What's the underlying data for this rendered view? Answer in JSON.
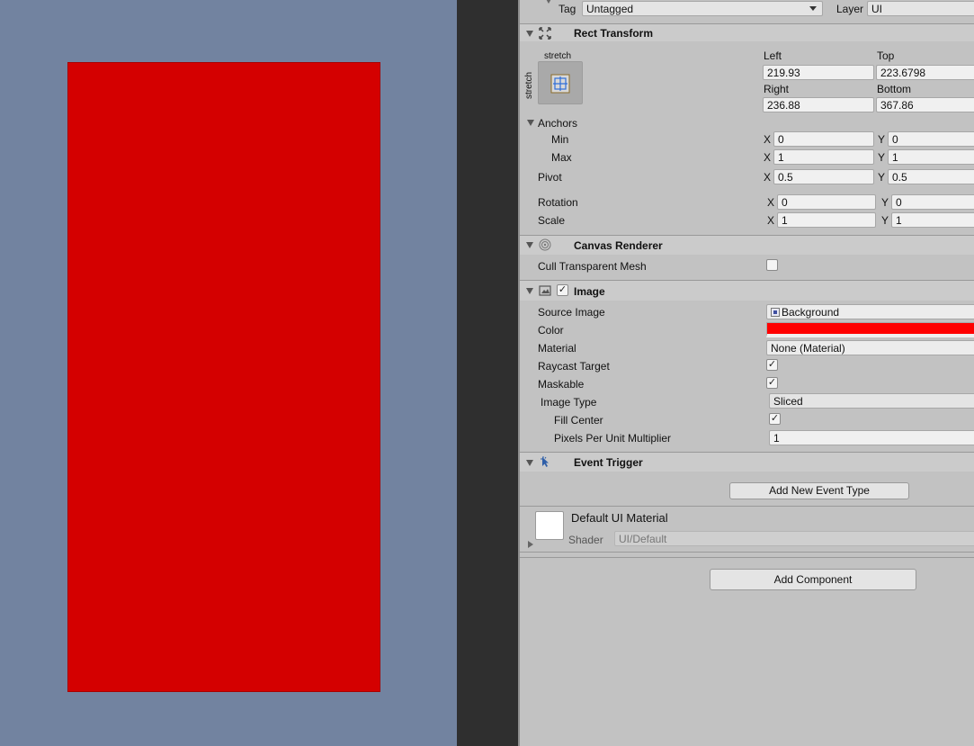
{
  "colors": {
    "scene_bg": "#7283a0",
    "image_red": "#d40000",
    "color_field": "#ff0000"
  },
  "top": {
    "tag_label": "Tag",
    "tag_value": "Untagged",
    "layer_label": "Layer",
    "layer_value": "UI"
  },
  "rect_transform": {
    "title": "Rect Transform",
    "anchor_preset_h": "stretch",
    "anchor_preset_v": "stretch",
    "left_label": "Left",
    "left_value": "219.93",
    "top_label": "Top",
    "top_value": "223.6798",
    "right_label": "Right",
    "right_value": "236.88",
    "bottom_label": "Bottom",
    "bottom_value": "367.86",
    "anchors_label": "Anchors",
    "min_label": "Min",
    "min_x": "0",
    "min_y": "0",
    "max_label": "Max",
    "max_x": "1",
    "max_y": "1",
    "pivot_label": "Pivot",
    "pivot_x": "0.5",
    "pivot_y": "0.5",
    "rotation_label": "Rotation",
    "rotation_x": "0",
    "rotation_y": "0",
    "scale_label": "Scale",
    "scale_x": "1",
    "scale_y": "1",
    "x_label": "X",
    "y_label": "Y"
  },
  "canvas_renderer": {
    "title": "Canvas Renderer",
    "cull_label": "Cull Transparent Mesh",
    "cull_checked": false
  },
  "image": {
    "title": "Image",
    "source_label": "Source Image",
    "source_value": "Background",
    "color_label": "Color",
    "material_label": "Material",
    "material_value": "None (Material)",
    "raycast_label": "Raycast Target",
    "maskable_label": "Maskable",
    "image_type_label": "Image Type",
    "image_type_value": "Sliced",
    "fill_center_label": "Fill Center",
    "ppu_label": "Pixels Per Unit Multiplier",
    "ppu_value": "1",
    "check_mark": "✓"
  },
  "event_trigger": {
    "title": "Event Trigger",
    "add_button": "Add New Event Type"
  },
  "material_preview": {
    "name": "Default UI Material",
    "shader_label": "Shader",
    "shader_value": "UI/Default"
  },
  "add_component": "Add Component"
}
